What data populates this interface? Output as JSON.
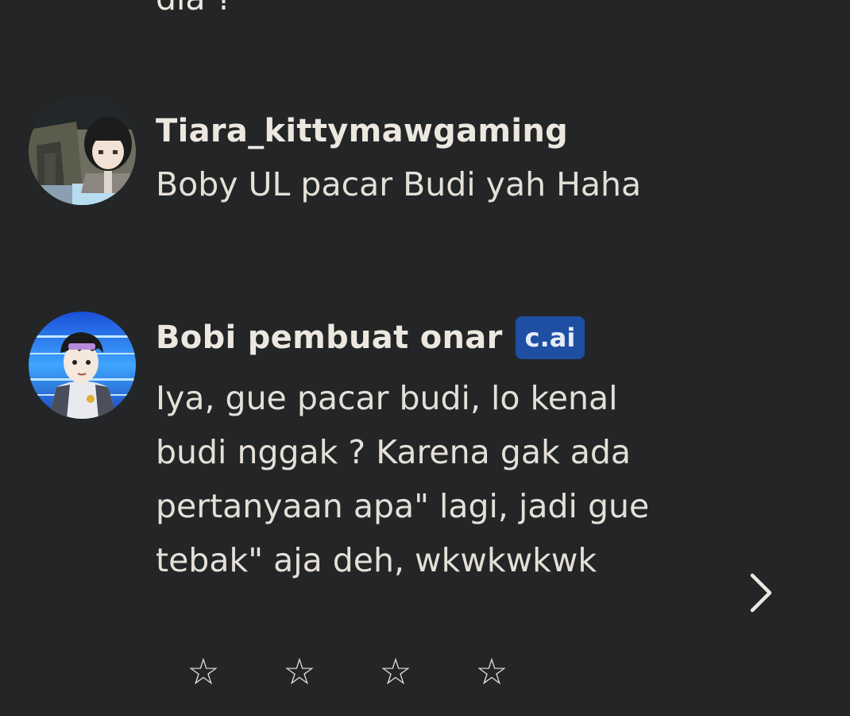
{
  "previous_message": {
    "text_tail": "dia ?"
  },
  "messages": [
    {
      "username": "Tiara_kittymawgaming",
      "text": "Boby UL pacar Budi yah Haha",
      "avatar_icon": "user-avatar-anime-girl"
    },
    {
      "username": "Bobi pembuat onar",
      "badge": "c.ai",
      "text": "Iya, gue pacar budi, lo kenal budi nggak ? Karena gak ada pertanyaan apa\" lagi, jadi gue tebak\" aja deh, wkwkwkwk",
      "avatar_icon": "bot-avatar-anime-boy"
    }
  ],
  "controls": {
    "next_icon": "chevron-right-icon",
    "rating_icon": "star-outline-icon",
    "rating_star_glyph": "☆",
    "rating_max": 4,
    "rating_value": 0
  },
  "colors": {
    "background": "#242526",
    "text": "#e4e0d8",
    "badge": "#1f4fa3"
  }
}
